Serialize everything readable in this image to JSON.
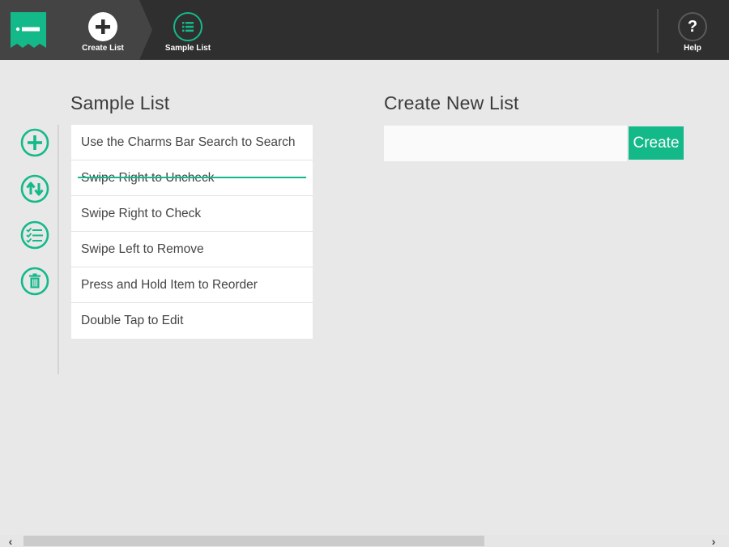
{
  "header": {
    "nav": [
      {
        "label": "Create List",
        "icon": "plus-icon",
        "active": true
      },
      {
        "label": "Sample List",
        "icon": "list-icon",
        "active": false
      }
    ],
    "help": {
      "label": "Help",
      "icon": "question-icon"
    }
  },
  "tools": [
    {
      "name": "add",
      "icon": "plus-circle-icon"
    },
    {
      "name": "reorder",
      "icon": "sort-arrows-icon"
    },
    {
      "name": "check-all",
      "icon": "checklist-icon"
    },
    {
      "name": "delete",
      "icon": "trash-icon"
    }
  ],
  "sample_list": {
    "title": "Sample List",
    "items": [
      {
        "text": "Use the Charms Bar Search to Search",
        "checked": false
      },
      {
        "text": "Swipe Right to Uncheck",
        "checked": true
      },
      {
        "text": "Swipe Right to Check",
        "checked": false
      },
      {
        "text": "Swipe Left to Remove",
        "checked": false
      },
      {
        "text": "Press and Hold Item to Reorder",
        "checked": false
      },
      {
        "text": "Double Tap to Edit",
        "checked": false
      }
    ]
  },
  "create_new": {
    "title": "Create New List",
    "input_value": "",
    "button_label": "Create"
  },
  "scrollbar": {
    "left_arrow": "‹",
    "right_arrow": "›"
  },
  "colors": {
    "accent": "#14b98a",
    "header_bg": "#2f2f2f",
    "page_bg": "#e8e8e8"
  }
}
